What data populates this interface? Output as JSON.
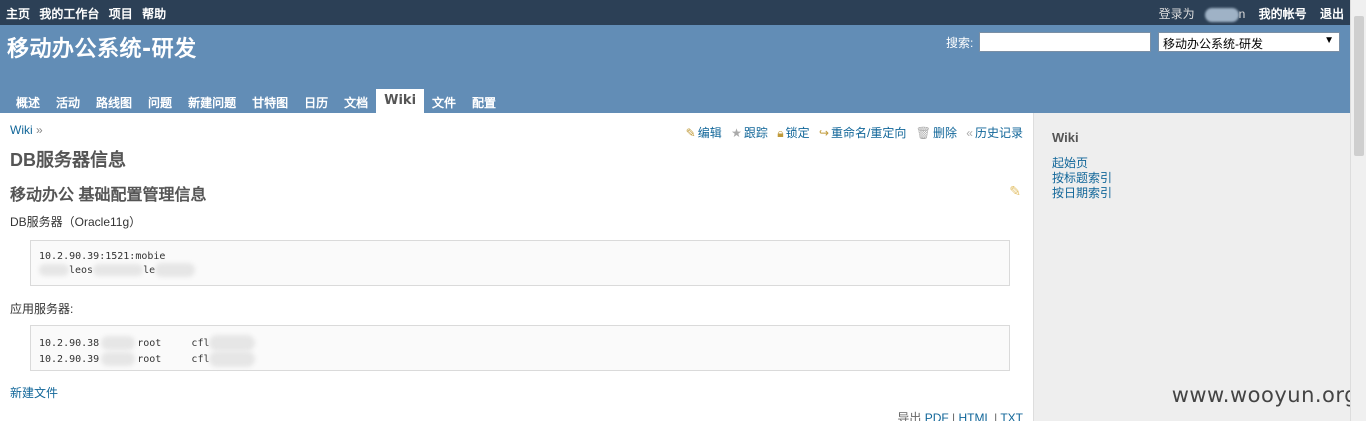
{
  "top_menu": {
    "left": [
      "主页",
      "我的工作台",
      "项目",
      "帮助"
    ],
    "logged_as": "登录为",
    "my_account": "我的帐号",
    "logout": "退出"
  },
  "header": {
    "title": "移动办公系统-研发",
    "search_label": "搜索:",
    "search_value": "",
    "project_select": "移动办公系统-研发"
  },
  "tabs": [
    "概述",
    "活动",
    "路线图",
    "问题",
    "新建问题",
    "甘特图",
    "日历",
    "文档",
    "Wiki",
    "文件",
    "配置"
  ],
  "selected_tab": "Wiki",
  "breadcrumb": {
    "link": "Wiki",
    "sep": "»"
  },
  "contextual": {
    "edit": "编辑",
    "watch": "跟踪",
    "lock": "锁定",
    "rename": "重命名/重定向",
    "delete": "删除",
    "history": "历史记录"
  },
  "content": {
    "page_title": "DB服务器信息",
    "section_title": "移动办公 基础配置管理信息",
    "db_label": "DB服务器（Oracle11g）",
    "db_pre_line1": "10.2.90.39:1521:mobie",
    "db_pre_line2_a": "leos",
    "db_pre_line2_b": "le",
    "app_label": "应用服务器:",
    "app_rows": [
      {
        "ip": "10.2.90.38",
        "user": "root",
        "pw": "cfl"
      },
      {
        "ip": "10.2.90.39",
        "user": "root",
        "pw": "cfl"
      }
    ],
    "new_file": "新建文件",
    "export_label": "导出",
    "export_pdf": "PDF",
    "export_html": "HTML",
    "export_txt": "TXT"
  },
  "sidebar": {
    "title": "Wiki",
    "links": [
      "起始页",
      "按标题索引",
      "按日期索引"
    ]
  },
  "watermark": "www.wooyun.org"
}
